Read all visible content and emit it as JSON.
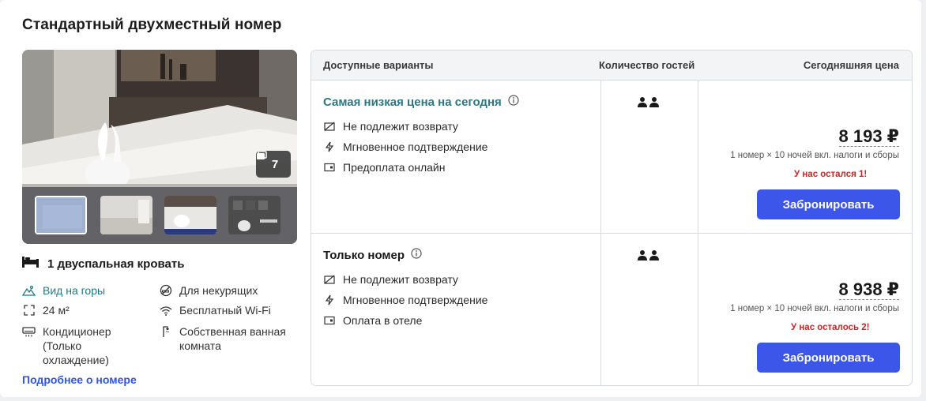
{
  "room": {
    "title": "Стандартный двухместный номер",
    "photo_count": "7",
    "bed": "1 двуспальная кровать",
    "features": [
      {
        "icon": "mountain-view-icon",
        "label": "Вид на горы"
      },
      {
        "icon": "no-smoking-icon",
        "label": "Для некурящих"
      },
      {
        "icon": "room-size-icon",
        "label": "24 м²"
      },
      {
        "icon": "wifi-icon",
        "label": "Бесплатный Wi-Fi"
      },
      {
        "icon": "air-conditioner-icon",
        "label": "Кондиционер\n(Только\nохлаждение)"
      },
      {
        "icon": "shower-icon",
        "label": "Собственная ванная\nкомната"
      }
    ],
    "more_link": "Подробнее о номере"
  },
  "table": {
    "headers": {
      "options": "Доступные варианты",
      "guests": "Количество гостей",
      "price": "Сегодняшняя цена"
    },
    "offers": [
      {
        "title": "Самая низкая цена на сегодня",
        "conditions": [
          "Не подлежит возврату",
          "Мгновенное подтверждение",
          "Предоплата онлайн"
        ],
        "price": "8 193 ₽",
        "price_note": "1 номер × 10 ночей вкл. налоги и сборы",
        "availability": "У нас остался 1!",
        "book_label": "Забронировать"
      },
      {
        "title": "Только номер",
        "conditions": [
          "Не подлежит возврату",
          "Мгновенное подтверждение",
          "Оплата в отеле"
        ],
        "price": "8 938 ₽",
        "price_note": "1 номер × 10 ночей вкл. налоги и сборы",
        "availability": "У нас осталось 2!",
        "book_label": "Забронировать"
      }
    ]
  },
  "colors": {
    "accent_blue": "#3b56e8",
    "teal": "#2a7886",
    "warning_red": "#c62828",
    "link_blue": "#2c56e6"
  }
}
